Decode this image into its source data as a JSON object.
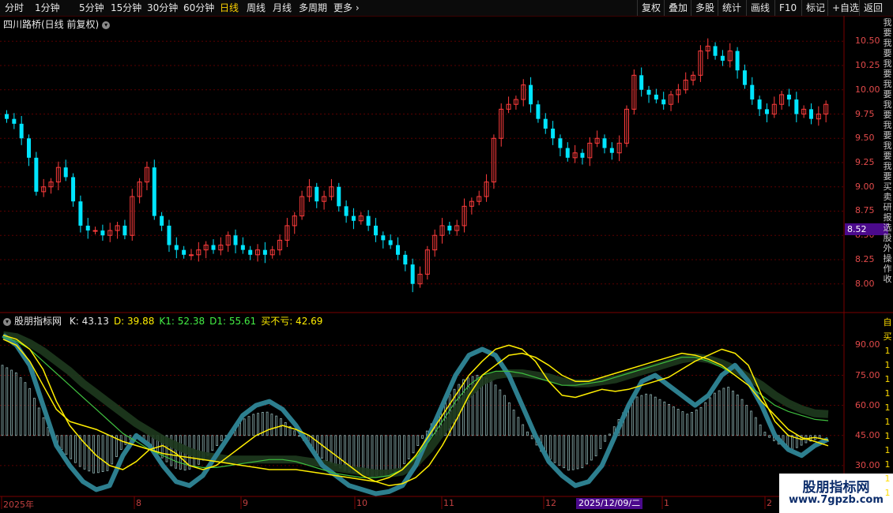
{
  "toolbar": {
    "periods": [
      "分时",
      "1分钟",
      "5分钟",
      "15分钟",
      "30分钟",
      "60分钟",
      "日线",
      "周线",
      "月线",
      "多周期",
      "更多"
    ],
    "active_period": "日线",
    "more_arrow": "›",
    "right_buttons": [
      "复权",
      "叠加",
      "多股",
      "统计",
      "画线",
      "F10",
      "标记",
      "+自选",
      "返回"
    ]
  },
  "stock": {
    "title": "四川路桥(日线 前复权)",
    "current_price_tag": "8.52"
  },
  "price_axis": [
    "10.50",
    "10.25",
    "10.00",
    "9.75",
    "9.50",
    "9.25",
    "9.00",
    "8.75",
    "8.50",
    "8.25",
    "8.00"
  ],
  "indicator": {
    "name": "股朋指标网",
    "values": [
      {
        "label": "K: 43.13",
        "color": "#e8e8e8"
      },
      {
        "label": "D: 39.88",
        "color": "#ffee00"
      },
      {
        "label": "K1: 52.38",
        "color": "#44ee44"
      },
      {
        "label": "D1: 55.61",
        "color": "#44ee44"
      },
      {
        "label": "买不亏: 42.69",
        "color": "#ffee00"
      }
    ],
    "axis": [
      "90.00",
      "75.00",
      "60.00",
      "45.00",
      "30.00"
    ]
  },
  "x_axis": {
    "labels": [
      "2025年",
      "8",
      "9",
      "10",
      "11",
      "12",
      "1",
      "2"
    ],
    "cursor_date": "2025/12/09/二"
  },
  "side_strip": {
    "top": [
      "我",
      "要",
      "我",
      "要",
      "我",
      "要",
      "我",
      "要",
      "我",
      "要",
      "我",
      "要",
      "我",
      "要",
      "我",
      "要",
      "买",
      "卖",
      "研",
      "报",
      "选",
      "股",
      "外",
      "操",
      "作",
      "收"
    ],
    "bottom": [
      "自",
      "买",
      "1",
      "1",
      "1",
      "1",
      "1",
      "1",
      "1",
      "1",
      "1",
      "1",
      "1"
    ]
  },
  "watermark": {
    "line1": "股朋指标网",
    "line2": "www.7gpzb.com"
  },
  "colors": {
    "up": "#ff3c3c",
    "down": "#00e5ff",
    "grid": "#5a0000",
    "axis_text": "#e24a4a"
  },
  "chart_data": [
    {
      "type": "candlestick",
      "title": "四川路桥(日线 前复权)",
      "y_axis_ticks": [
        8.0,
        8.25,
        8.5,
        8.75,
        9.0,
        9.25,
        9.5,
        9.75,
        10.0,
        10.25,
        10.5
      ],
      "ylim": [
        7.9,
        10.6
      ],
      "x_ticks": [
        "2025年",
        "8",
        "9",
        "10",
        "11",
        "12",
        "1",
        "2"
      ],
      "close_series": [
        9.7,
        9.65,
        9.5,
        9.3,
        8.95,
        9.0,
        9.05,
        9.2,
        9.1,
        8.85,
        8.6,
        8.55,
        8.55,
        8.5,
        8.55,
        8.6,
        8.5,
        8.9,
        9.05,
        9.2,
        8.7,
        8.6,
        8.4,
        8.35,
        8.3,
        8.3,
        8.35,
        8.4,
        8.35,
        8.4,
        8.5,
        8.4,
        8.35,
        8.3,
        8.35,
        8.3,
        8.35,
        8.45,
        8.6,
        8.7,
        8.9,
        9.0,
        8.85,
        8.9,
        9.0,
        8.8,
        8.7,
        8.65,
        8.7,
        8.6,
        8.5,
        8.45,
        8.4,
        8.3,
        8.2,
        8.0,
        8.1,
        8.35,
        8.5,
        8.6,
        8.55,
        8.6,
        8.8,
        8.85,
        8.9,
        9.05,
        9.5,
        9.8,
        9.85,
        9.9,
        10.05,
        9.85,
        9.7,
        9.6,
        9.5,
        9.4,
        9.3,
        9.35,
        9.3,
        9.45,
        9.5,
        9.4,
        9.35,
        9.45,
        9.8,
        10.15,
        10.0,
        9.95,
        9.9,
        9.85,
        9.95,
        10.0,
        10.1,
        10.15,
        10.4,
        10.45,
        10.35,
        10.3,
        10.4,
        10.2,
        10.05,
        9.9,
        9.8,
        9.75,
        9.85,
        9.95,
        9.9,
        9.75,
        9.8,
        9.7,
        9.75,
        9.85
      ]
    },
    {
      "type": "line",
      "title": "股朋指标网",
      "y_axis_ticks": [
        30,
        45,
        60,
        75,
        90
      ],
      "ylim": [
        15,
        100
      ],
      "series": [
        {
          "name": "K",
          "last": 43.13,
          "values": [
            95,
            90,
            80,
            60,
            40,
            30,
            22,
            18,
            20,
            35,
            45,
            40,
            30,
            22,
            20,
            25,
            35,
            45,
            55,
            60,
            62,
            58,
            50,
            40,
            30,
            25,
            20,
            18,
            16,
            17,
            20,
            30,
            45,
            60,
            75,
            85,
            88,
            85,
            75,
            60,
            45,
            32,
            25,
            20,
            22,
            30,
            45,
            60,
            72,
            75,
            70,
            65,
            60,
            65,
            75,
            80,
            72,
            60,
            45,
            38,
            35,
            40,
            43.13
          ]
        },
        {
          "name": "D",
          "last": 39.88,
          "values": [
            95,
            93,
            88,
            78,
            62,
            50,
            42,
            35,
            30,
            28,
            32,
            38,
            40,
            36,
            30,
            28,
            30,
            35,
            40,
            45,
            48,
            50,
            48,
            45,
            40,
            35,
            30,
            25,
            22,
            20,
            21,
            24,
            30,
            40,
            52,
            65,
            75,
            80,
            85,
            86,
            84,
            80,
            75,
            72,
            72,
            74,
            76,
            78,
            80,
            82,
            84,
            86,
            85,
            83,
            80,
            75,
            70,
            62,
            55,
            48,
            44,
            42,
            39.88
          ]
        },
        {
          "name": "K1",
          "last": 52.38,
          "values": [
            94,
            92,
            88,
            82,
            76,
            70,
            64,
            58,
            52,
            46,
            42,
            38,
            35,
            32,
            30,
            29,
            29,
            30,
            31,
            32,
            33,
            33,
            32,
            30,
            28,
            26,
            25,
            24,
            24,
            25,
            28,
            34,
            42,
            52,
            62,
            70,
            75,
            77,
            77,
            76,
            74,
            72,
            70,
            70,
            71,
            72,
            74,
            76,
            78,
            80,
            82,
            84,
            84,
            82,
            79,
            75,
            70,
            65,
            60,
            57,
            55,
            53,
            52.38
          ]
        },
        {
          "name": "D1",
          "last": 55.61,
          "values": [
            95,
            94,
            91,
            87,
            82,
            77,
            71,
            66,
            61,
            56,
            51,
            47,
            43,
            40,
            37,
            35,
            34,
            33,
            33,
            33,
            33,
            33,
            33,
            32,
            31,
            29,
            28,
            27,
            26,
            26,
            27,
            31,
            38,
            47,
            57,
            66,
            72,
            75,
            76,
            76,
            75,
            74,
            72,
            71,
            71,
            72,
            73,
            75,
            77,
            79,
            81,
            83,
            84,
            83,
            81,
            78,
            74,
            70,
            65,
            61,
            58,
            56,
            55.61
          ]
        },
        {
          "name": "买不亏",
          "last": 42.69,
          "values": [
            93,
            90,
            82,
            70,
            58,
            52,
            50,
            48,
            45,
            42,
            40,
            38,
            36,
            35,
            34,
            33,
            32,
            31,
            30,
            29,
            28,
            28,
            28,
            27,
            26,
            25,
            24,
            23,
            22,
            24,
            28,
            35,
            45,
            55,
            65,
            75,
            82,
            88,
            90,
            88,
            82,
            72,
            65,
            64,
            66,
            68,
            67,
            68,
            70,
            72,
            74,
            78,
            82,
            85,
            88,
            86,
            80,
            65,
            52,
            45,
            43,
            44,
            42.69
          ]
        }
      ]
    }
  ]
}
